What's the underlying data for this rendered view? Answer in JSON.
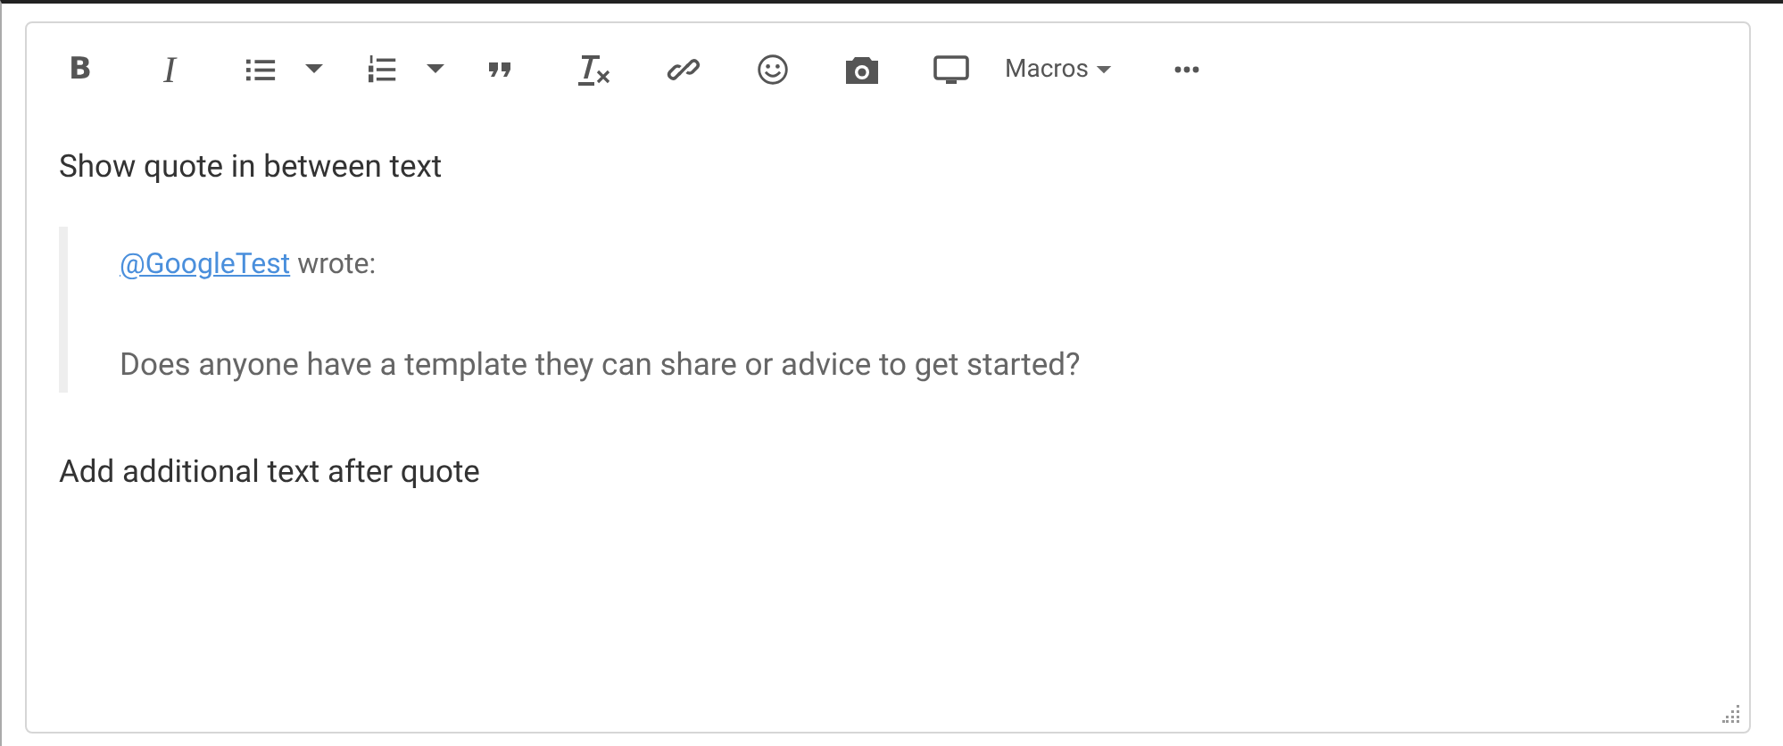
{
  "toolbar": [
    {
      "kind": "bold",
      "text": "B"
    },
    {
      "kind": "italic",
      "text": "I"
    },
    {
      "kind": "bullets"
    },
    {
      "kind": "caret"
    },
    {
      "kind": "numbered"
    },
    {
      "kind": "caret"
    },
    {
      "kind": "quote"
    },
    {
      "kind": "clear"
    },
    {
      "kind": "link"
    },
    {
      "kind": "emoji"
    },
    {
      "kind": "camera"
    },
    {
      "kind": "screen"
    },
    {
      "kind": "dropdown",
      "text": "Macros"
    },
    {
      "kind": "more"
    }
  ],
  "content": [
    {
      "kind": "paragraph",
      "text": "Show quote in between text"
    },
    {
      "kind": "quote",
      "mention": "@GoogleTest",
      "after_mention": " wrote:",
      "body": "Does anyone have a template they can share or advice to get started?"
    },
    {
      "kind": "paragraph",
      "text": "Add additional text after quote"
    }
  ]
}
